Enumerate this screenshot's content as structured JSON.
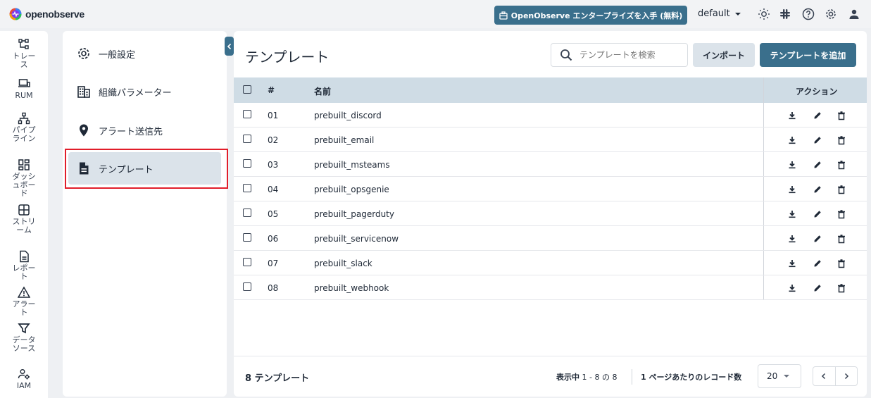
{
  "app": {
    "logo_text": "openobserve",
    "enterprise_button": "OpenObserve エンタープライズを入手 (無料)",
    "org": "default"
  },
  "nav": [
    {
      "label": "トレース",
      "icon": "traces-icon"
    },
    {
      "label": "RUM",
      "icon": "rum-icon"
    },
    {
      "label": "パイプライン",
      "icon": "pipeline-icon"
    },
    {
      "label": "ダッシュボード",
      "icon": "dashboard-icon"
    },
    {
      "label": "ストリーム",
      "icon": "stream-icon"
    },
    {
      "label": "レポート",
      "icon": "report-icon"
    },
    {
      "label": "アラート",
      "icon": "alert-icon"
    },
    {
      "label": "データソース",
      "icon": "datasource-icon"
    },
    {
      "label": "IAM",
      "icon": "iam-icon"
    }
  ],
  "settings_menu": [
    {
      "label": "一般設定",
      "icon": "gear-icon"
    },
    {
      "label": "組織パラメーター",
      "icon": "building-icon"
    },
    {
      "label": "アラート送信先",
      "icon": "location-pin-icon"
    },
    {
      "label": "テンプレート",
      "icon": "document-icon",
      "active": true
    }
  ],
  "main": {
    "title": "テンプレート",
    "search_placeholder": "テンプレートを検索",
    "import_label": "インポート",
    "add_label": "テンプレートを追加",
    "columns": {
      "num": "#",
      "name": "名前",
      "actions": "アクション"
    },
    "rows": [
      {
        "num": "01",
        "name": "prebuilt_discord"
      },
      {
        "num": "02",
        "name": "prebuilt_email"
      },
      {
        "num": "03",
        "name": "prebuilt_msteams"
      },
      {
        "num": "04",
        "name": "prebuilt_opsgenie"
      },
      {
        "num": "05",
        "name": "prebuilt_pagerduty"
      },
      {
        "num": "06",
        "name": "prebuilt_servicenow"
      },
      {
        "num": "07",
        "name": "prebuilt_slack"
      },
      {
        "num": "08",
        "name": "prebuilt_webhook"
      }
    ],
    "footer": {
      "count": "8 テンプレート",
      "showing_prefix": "表示中",
      "showing_range": "1 - 8 の 8",
      "per_page_label": "1 ページあたりのレコード数",
      "per_page": "20"
    }
  },
  "colors": {
    "accent": "#3a6f8c",
    "header_bg": "#cfdce5",
    "highlight": "#e11d2a"
  }
}
